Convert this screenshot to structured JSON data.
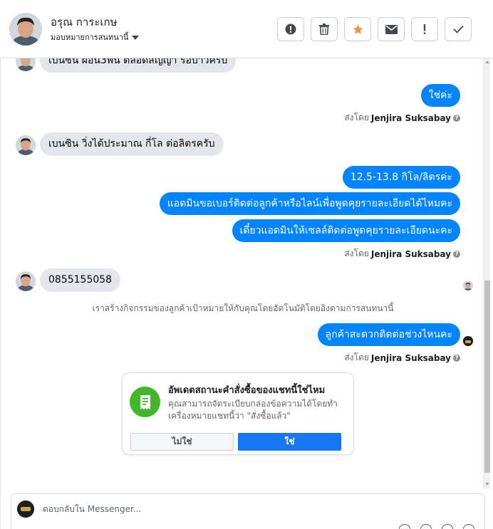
{
  "header": {
    "contact_name": "อรุณ การะเกษ",
    "assign_label": "มอบหมายการสนทนานี้",
    "actions": [
      "spam-icon",
      "trash-icon",
      "star-icon",
      "mail-icon",
      "exclamation-icon",
      "check-icon"
    ]
  },
  "messages": {
    "m0": "เบนซิน ผ่อน3พัน ตลอดสัญญา รอบาวครับ",
    "m1": "ใช่ค่ะ",
    "m2": "เบนซิน วิ่งได้ประมาณ กี่โล ต่อลิตรครับ",
    "m3": "12.5-13.8 กิโล/ลิตรค่ะ",
    "m4": "แอดมินขอเบอร์ติดต่อลูกค้าหรือไลน์เพื่อพูดคุยรายละเอียดได้ไหมคะ",
    "m5": "เดี๋ยวแอดมินให้เซลล์ติดต่อพูดคุยรายละเอียดนะคะ",
    "m6": "0855155058",
    "m7": "ลูกค้าสะดวกติดต่อช่วงไหนคะ"
  },
  "sent_by": {
    "prefix": "ส่งโดย",
    "name": "Jenjira Suksabay",
    "help": "?"
  },
  "system_note": "เราสร้างกิจกรรมของลูกค้าเป้าหมายให้กับคุณโดยอัตโนมัติโดยอิงตามการสนทนานี้",
  "order_card": {
    "title": "อัพเดตสถานะคำสั่งซื้อของแชทนี้ใช่ไหม",
    "description": "คุณสามารถจัดระเบียบกล่องข้อความได้โดยทำเครื่องหมายแชทนี้ว่า \"สั่งซื้อแล้ว\"",
    "no_label": "ไม่ใช่",
    "yes_label": "ใช่"
  },
  "composer": {
    "placeholder": "ตอบกลับใน Messenger..."
  },
  "colors": {
    "outgoing": "#0084ff",
    "incoming": "#e4e6eb",
    "star": "#f5943c",
    "card_icon": "#42b72a",
    "yes_button": "#1877f2"
  }
}
